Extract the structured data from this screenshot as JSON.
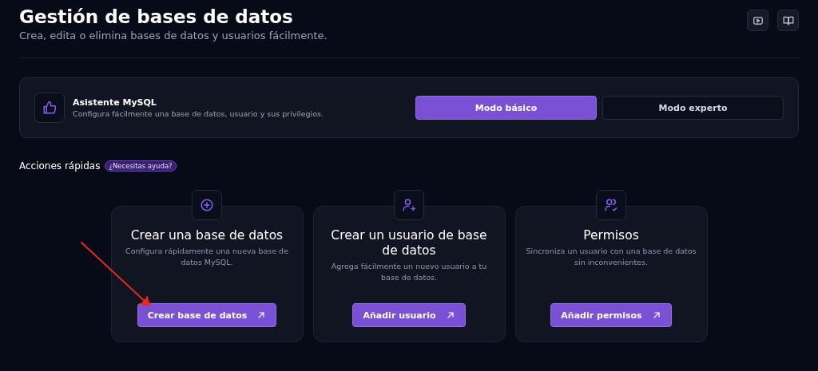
{
  "header": {
    "title": "Gestión de bases de datos",
    "subtitle": "Crea, edita o elimina bases de datos y usuarios fácilmente."
  },
  "assistant": {
    "title": "Asistente MySQL",
    "description": "Configura fácilmente una base de datos, usuario y sus privilegios.",
    "modes": [
      {
        "label": "Modo básico",
        "selected": true
      },
      {
        "label": "Modo experto",
        "selected": false
      }
    ]
  },
  "quick_actions": {
    "title": "Acciones rápidas",
    "help_badge": "¿Necesitas ayuda?",
    "cards": [
      {
        "title": "Crear una base de datos",
        "description": "Configura rápidamente una nueva base de datos MySQL.",
        "button": "Crear base de datos"
      },
      {
        "title": "Crear un usuario de base de datos",
        "description": "Agrega fácilmente un nuevo usuario a tu base de datos.",
        "button": "Añadir usuario"
      },
      {
        "title": "Permisos",
        "description": "Sincroniza un usuario con una base de datos sin inconvenientes.",
        "button": "Añadir permisos"
      }
    ]
  }
}
